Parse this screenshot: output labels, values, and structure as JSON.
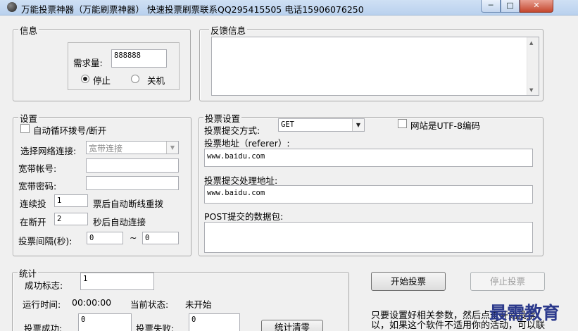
{
  "window": {
    "title": "万能投票神器（万能刷票神器）   快速投票刷票联系QQ295415505 电话15906076250",
    "min_glyph": "─",
    "max_glyph": "□",
    "close_glyph": "✕"
  },
  "info": {
    "legend": "信息",
    "demand_label": "需求量:",
    "demand_value": "888888",
    "radio_stop": "停止",
    "radio_shutdown": "关机"
  },
  "feedback": {
    "legend": "反馈信息"
  },
  "settings": {
    "legend": "设置",
    "auto_redial": "自动循环拨号/断开",
    "network_label": "选择网络连接:",
    "network_value": "宽带连接",
    "account_label": "宽带帐号:",
    "password_label": "宽带密码:",
    "continuous_label": "连续投",
    "continuous_value": "1",
    "continuous_suffix": "票后自动断线重拨",
    "disconnect_label": "在断开",
    "disconnect_value": "2",
    "disconnect_suffix": "秒后自动连接",
    "interval_label": "投票间隔(秒):",
    "interval_from": "0",
    "interval_sep": "~",
    "interval_to": "0"
  },
  "vote": {
    "legend": "投票设置",
    "method_label": "投票提交方式:",
    "method_value": "GET",
    "utf8_label": "网站是UTF-8编码",
    "referer_label": "投票地址（referer）:",
    "referer_value": "www.baidu.com",
    "handler_label": "投票提交处理地址:",
    "handler_value": "www.baidu.com",
    "post_label": "POST提交的数据包:"
  },
  "stats": {
    "legend": "统计",
    "success_flag_label": "成功标志:",
    "success_flag_value": "1",
    "runtime_label": "运行时间:",
    "runtime_value": "00:00:00",
    "status_label": "当前状态:",
    "status_value": "未开始",
    "success_label": "投票成功:",
    "success_value": "0",
    "fail_label": "投票失败:",
    "fail_value": "0",
    "clear_button": "统计清零"
  },
  "actions": {
    "start_button": "开始投票",
    "stop_button": "停止投票",
    "hint_line1": "只要设置好相关参数，然后点击开始投票",
    "hint_line2": "以，如果这个软件不适用你的活动，可以联"
  },
  "watermark": "最需教育"
}
